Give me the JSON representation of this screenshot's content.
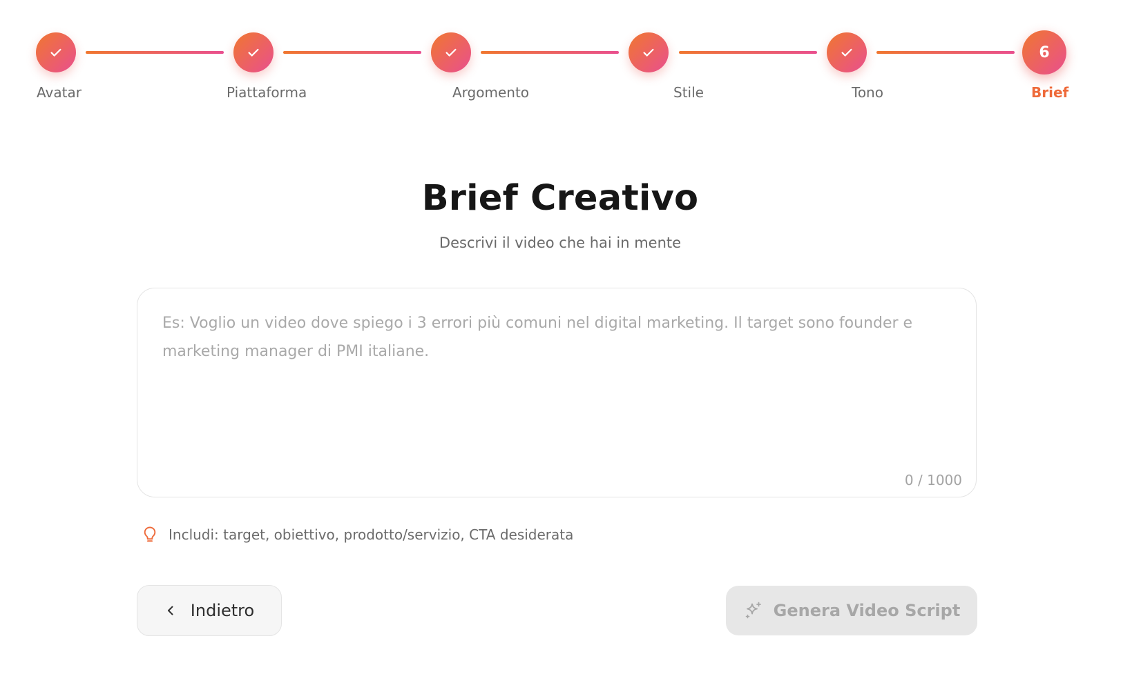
{
  "stepper": {
    "steps": [
      {
        "label": "Avatar",
        "status": "completed",
        "icon": "check-icon"
      },
      {
        "label": "Piattaforma",
        "status": "completed",
        "icon": "check-icon"
      },
      {
        "label": "Argomento",
        "status": "completed",
        "icon": "check-icon"
      },
      {
        "label": "Stile",
        "status": "completed",
        "icon": "check-icon"
      },
      {
        "label": "Tono",
        "status": "completed",
        "icon": "check-icon"
      },
      {
        "label": "Brief",
        "number": "6",
        "status": "current"
      }
    ]
  },
  "header": {
    "title": "Brief Creativo",
    "subtitle": "Descrivi il video che hai in mente"
  },
  "brief": {
    "value": "",
    "placeholder": "Es: Voglio un video dove spiego i 3 errori più comuni nel digital marketing. Il target sono founder e marketing manager di PMI italiane.",
    "counter": "0 / 1000"
  },
  "hint": {
    "icon": "lightbulb-icon",
    "text": "Includi: target, obiettivo, prodotto/servizio, CTA desiderata"
  },
  "actions": {
    "back_label": "Indietro",
    "back_icon": "chevron-left-icon",
    "generate_label": "Genera Video Script",
    "generate_icon": "sparkles-icon",
    "generate_disabled": true
  },
  "colors": {
    "accent_start": "#f0772f",
    "accent_end": "#e94f8f",
    "current_label": "#ee6a3a",
    "disabled_bg": "#e7e7e7"
  }
}
